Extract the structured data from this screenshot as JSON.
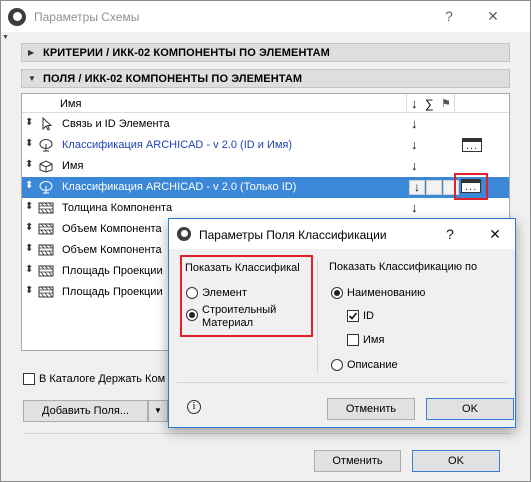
{
  "window": {
    "title": "Параметры Схемы",
    "help_glyph": "?",
    "close_glyph": "✕"
  },
  "sections": [
    {
      "label": "КРИТЕРИИ / ИКК-02 КОМПОНЕНТЫ ПО ЭЛЕМЕНТАМ",
      "expanded": false
    },
    {
      "label": "ПОЛЯ / ИКК-02 КОМПОНЕНТЫ ПО ЭЛЕМЕНТАМ",
      "expanded": true
    }
  ],
  "list": {
    "header": {
      "name": "Имя",
      "sort_glyph": "↓",
      "sum_glyph": "∑",
      "flag_glyph": "⚑"
    },
    "rows": [
      {
        "icon": "cursor-icon",
        "label": "Связь и ID Элемента",
        "blue": false,
        "selected": false
      },
      {
        "icon": "classification-tree-icon",
        "label": "Классификация ARCHICAD - v 2.0 (ID и Имя)",
        "blue": true,
        "selected": false
      },
      {
        "icon": "element-3d-icon",
        "label": "Имя",
        "blue": false,
        "selected": false
      },
      {
        "icon": "classification-tree-icon",
        "label": "Классификация ARCHICAD - v 2.0 (Только ID)",
        "blue": false,
        "selected": true
      },
      {
        "icon": "layers-icon",
        "label": "Толщина Компонента",
        "blue": false,
        "selected": false
      },
      {
        "icon": "layers-icon",
        "label": "Объем Компонента",
        "blue": false,
        "selected": false
      },
      {
        "icon": "layers-icon",
        "label": "Объем Компонента",
        "blue": false,
        "selected": false
      },
      {
        "icon": "layers-icon",
        "label": "Площадь Проекции",
        "blue": false,
        "selected": false
      },
      {
        "icon": "layers-icon",
        "label": "Площадь Проекции",
        "blue": false,
        "selected": false
      }
    ],
    "down_glyph": "↓",
    "dots_glyph": "..."
  },
  "catalog_checkbox": {
    "label": "В Каталоге Держать Ком",
    "checked": false
  },
  "add_field_button": {
    "label": "Добавить Поля...",
    "arrow": "▼"
  },
  "main_buttons": {
    "cancel": "Отменить",
    "ok": "OK"
  },
  "dialog": {
    "title": "Параметры Поля Классификации",
    "help_glyph": "?",
    "close_glyph": "✕",
    "left_group": {
      "heading": "Показать Классификаl",
      "options": [
        {
          "label": "Элемент",
          "selected": false
        },
        {
          "label": "Строительный Материал",
          "selected": true
        }
      ]
    },
    "right_group": {
      "heading": "Показать Классификацию по",
      "name_option": {
        "label": "Наименованию",
        "selected": true
      },
      "checks": [
        {
          "label": "ID",
          "checked": true
        },
        {
          "label": "Имя",
          "checked": false
        }
      ],
      "desc_option": {
        "label": "Описание",
        "selected": false
      }
    },
    "info_glyph": "i",
    "cancel": "Отменить",
    "ok": "OK"
  },
  "colors": {
    "selection": "#3b88d8",
    "accent_red": "#e0202a",
    "link_blue": "#1f44b8",
    "focus_blue": "#2b7bd6"
  }
}
